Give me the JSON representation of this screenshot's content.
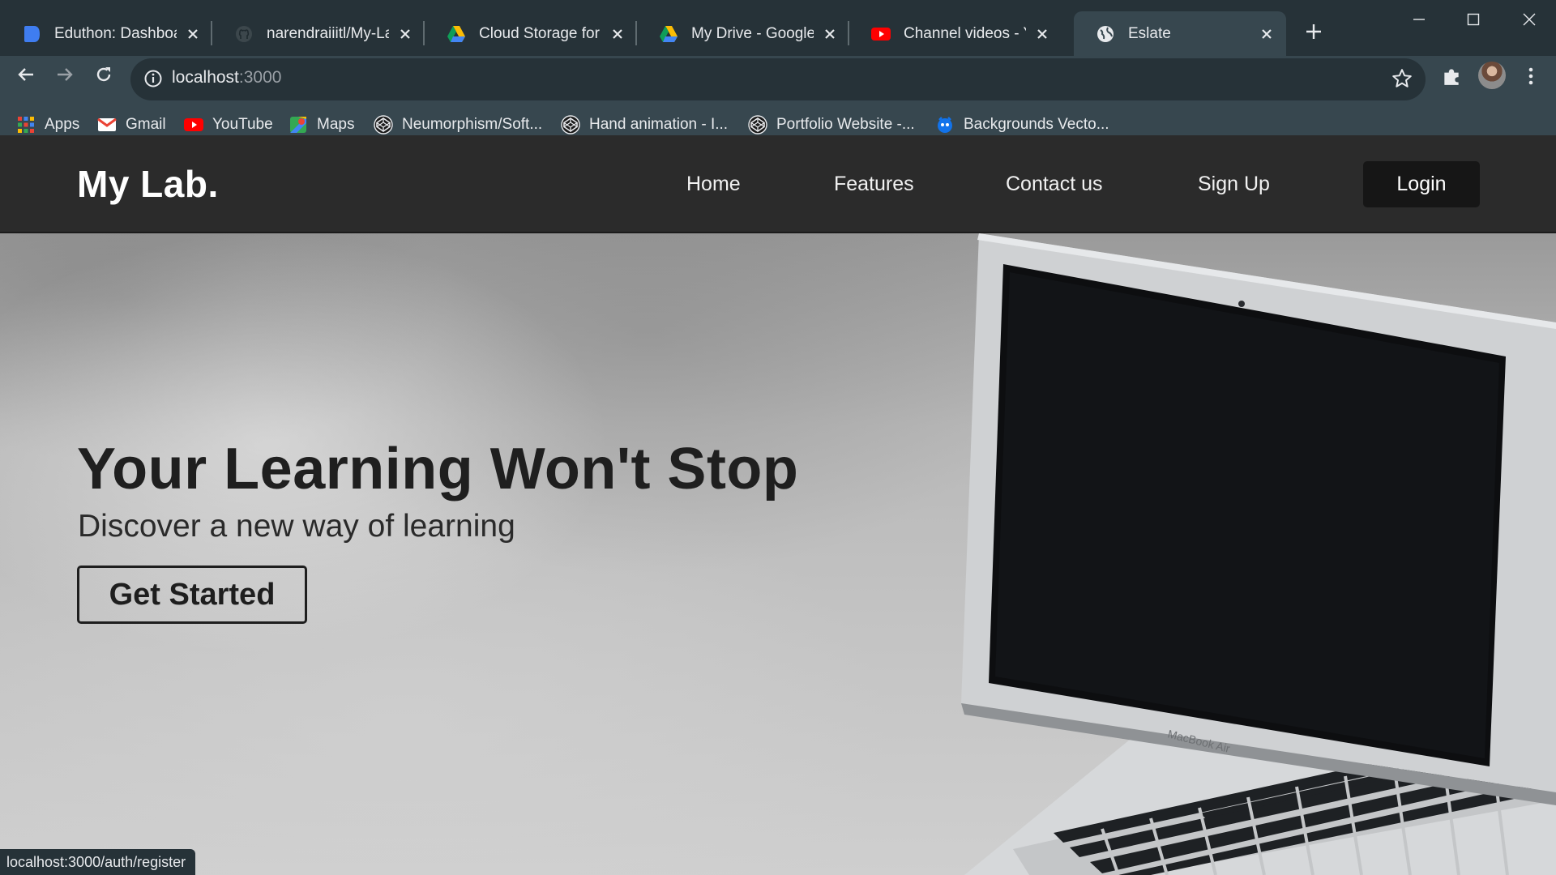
{
  "browser": {
    "tabs": [
      {
        "title": "Eduthon: Dashboard",
        "icon": "eduthon-icon",
        "active": false
      },
      {
        "title": "narendraiiitl/My-Lab",
        "icon": "github-icon",
        "active": false
      },
      {
        "title": "Cloud Storage for W",
        "icon": "google-drive-icon",
        "active": false
      },
      {
        "title": "My Drive - Google D",
        "icon": "google-drive-icon",
        "active": false
      },
      {
        "title": "Channel videos - You",
        "icon": "youtube-icon",
        "active": false
      },
      {
        "title": "Eslate",
        "icon": "globe-icon",
        "active": true
      }
    ],
    "address": {
      "host": "localhost",
      "port": ":3000"
    },
    "bookmarks": [
      {
        "label": "Apps",
        "icon": "apps-grid-icon"
      },
      {
        "label": "Gmail",
        "icon": "gmail-icon"
      },
      {
        "label": "YouTube",
        "icon": "youtube-icon"
      },
      {
        "label": "Maps",
        "icon": "maps-icon"
      },
      {
        "label": "Neumorphism/Soft...",
        "icon": "codepen-icon"
      },
      {
        "label": "Hand animation - I...",
        "icon": "codepen-icon"
      },
      {
        "label": "Portfolio Website -...",
        "icon": "codepen-icon"
      },
      {
        "label": "Backgrounds Vecto...",
        "icon": "freepik-icon"
      }
    ],
    "status_url": "localhost:3000/auth/register"
  },
  "site": {
    "brand": "My Lab.",
    "nav": [
      "Home",
      "Features",
      "Contact us",
      "Sign Up"
    ],
    "login_label": "Login",
    "hero": {
      "title": "Your Learning Won't Stop",
      "subtitle": "Discover a new way of learning",
      "cta": "Get Started"
    },
    "laptop_label": "MacBook Air"
  },
  "colors": {
    "tabstrip": "#263238",
    "toolbar": "#37474f",
    "site_header": "#2b2b2b",
    "login_button": "#161616"
  }
}
